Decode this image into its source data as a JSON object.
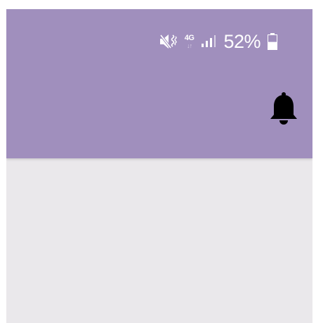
{
  "status_bar": {
    "icons": {
      "sound": "mute-vibrate-icon",
      "network": "4g-data-icon",
      "signal": "signal-strength-icon",
      "battery": "battery-icon"
    },
    "network_type": "4G",
    "battery_percent": "52%",
    "battery_level": 0.52
  },
  "app_bar": {
    "background_color": "#a08fbd",
    "action_icon": "notification-bell-icon"
  },
  "content": {
    "background_color": "#eae8eb"
  }
}
